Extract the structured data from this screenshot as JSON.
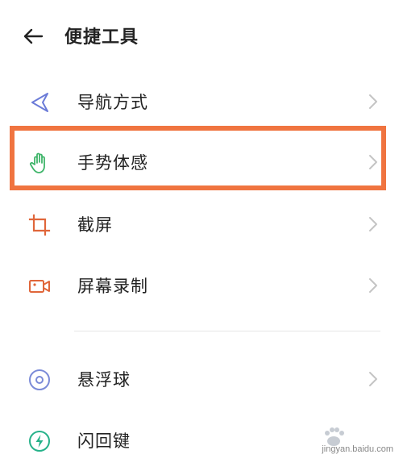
{
  "header": {
    "title": "便捷工具",
    "back_icon": "arrow-left-icon"
  },
  "colors": {
    "accent_highlight": "#f07440",
    "nav_icon": "#6b7bd8",
    "gesture_icon": "#3fb56a",
    "screenshot_icon": "#e0663a",
    "record_icon": "#e0663a",
    "float_icon": "#7b8bd8",
    "flash_icon": "#27b28a"
  },
  "items": [
    {
      "label": "导航方式",
      "icon": "navigation-icon"
    },
    {
      "label": "手势体感",
      "icon": "hand-gesture-icon"
    },
    {
      "label": "截屏",
      "icon": "crop-icon"
    },
    {
      "label": "屏幕录制",
      "icon": "video-record-icon"
    },
    {
      "label": "悬浮球",
      "icon": "floating-ball-icon"
    },
    {
      "label": "闪回键",
      "icon": "flashback-key-icon"
    }
  ],
  "watermark": {
    "text": "jingyan.baidu.com"
  }
}
